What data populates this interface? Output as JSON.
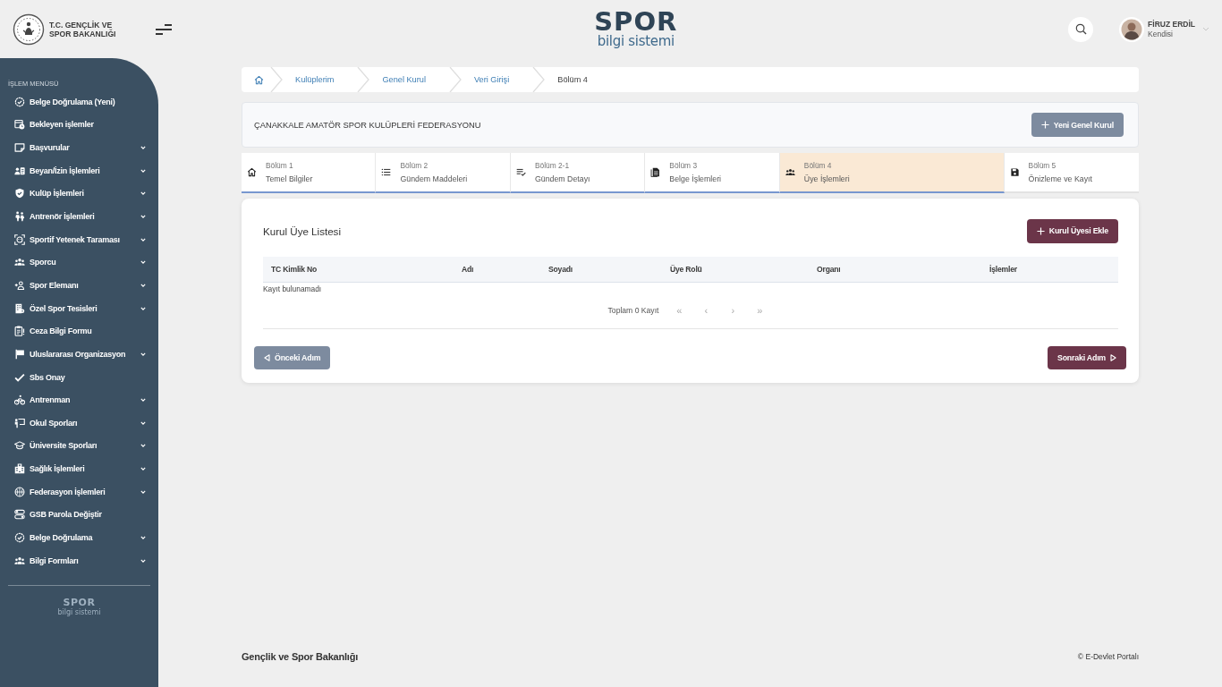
{
  "header": {
    "ministry_logo": {
      "lines": [
        "T.C. GENÇLİK VE",
        "SPOR BAKANLIĞI"
      ]
    },
    "app_logo": {
      "title": "SPOR",
      "subtitle": "bilgi sistemi"
    },
    "user": {
      "name": "FİRUZ ERDİL",
      "role": "Kendisi"
    }
  },
  "sidebar": {
    "heading": "İŞLEM MENÜSÜ",
    "items": [
      {
        "label": "Belge Doğrulama (Yeni)",
        "has_submenu": false
      },
      {
        "label": "Bekleyen işlemler",
        "has_submenu": false
      },
      {
        "label": "Başvurular",
        "has_submenu": true
      },
      {
        "label": "Beyan/İzin İşlemleri",
        "has_submenu": true
      },
      {
        "label": "Kulüp İşlemleri",
        "has_submenu": true
      },
      {
        "label": "Antrenör İşlemleri",
        "has_submenu": true
      },
      {
        "label": "Sportif Yetenek Taraması",
        "has_submenu": true
      },
      {
        "label": "Sporcu",
        "has_submenu": true
      },
      {
        "label": "Spor Elemanı",
        "has_submenu": true
      },
      {
        "label": "Özel Spor Tesisleri",
        "has_submenu": true
      },
      {
        "label": "Ceza Bilgi Formu",
        "has_submenu": false
      },
      {
        "label": "Uluslararası Organizasyon",
        "has_submenu": true
      },
      {
        "label": "Sbs Onay",
        "has_submenu": false
      },
      {
        "label": "Antrenman",
        "has_submenu": true
      },
      {
        "label": "Okul Sporları",
        "has_submenu": true
      },
      {
        "label": "Üniversite Sporları",
        "has_submenu": true
      },
      {
        "label": "Sağlık İşlemleri",
        "has_submenu": true
      },
      {
        "label": "Federasyon İşlemleri",
        "has_submenu": true
      },
      {
        "label": "GSB Parola Değiştir",
        "has_submenu": false
      },
      {
        "label": "Belge Doğrulama",
        "has_submenu": true
      },
      {
        "label": "Bilgi Formları",
        "has_submenu": true
      }
    ],
    "footer_logo": {
      "title": "SPOR",
      "subtitle": "bilgi sistemi"
    }
  },
  "breadcrumb": [
    {
      "label": "Kulüplerim",
      "current": false
    },
    {
      "label": "Genel Kurul",
      "current": false
    },
    {
      "label": "Veri Girişi",
      "current": false
    },
    {
      "label": "Bölüm 4",
      "current": true
    }
  ],
  "organization": {
    "name": "ÇANAKKALE AMATÖR SPOR KULÜPLERİ FEDERASYONU",
    "button": "Yeni Genel Kurul"
  },
  "steps": [
    {
      "step": "Bölüm 1",
      "title": "Temel Bilgiler",
      "selected": false,
      "reached": true
    },
    {
      "step": "Bölüm 2",
      "title": "Gündem Maddeleri",
      "selected": false,
      "reached": true
    },
    {
      "step": "Bölüm 2-1",
      "title": "Gündem Detayı",
      "selected": false,
      "reached": true
    },
    {
      "step": "Bölüm 3",
      "title": "Belge İşlemleri",
      "selected": false,
      "reached": true
    },
    {
      "step": "Bölüm 4",
      "title": "Üye İşlemleri",
      "selected": true,
      "reached": true
    },
    {
      "step": "Bölüm 5",
      "title": "Önizleme ve Kayıt",
      "selected": false,
      "reached": false
    }
  ],
  "members": {
    "title": "Kurul Üye Listesi",
    "add_button": "Kurul Üyesi Ekle",
    "table": {
      "columns": [
        "TC Kimlik No",
        "Adı",
        "Soyadı",
        "Üye Rolü",
        "Organı",
        "İşlemler"
      ],
      "empty_message": "Kayıt bulunamadı"
    },
    "pagination": {
      "summary": "Toplam 0 Kayıt",
      "buttons": [
        {
          "label": "«",
          "disabled": true
        },
        {
          "label": "‹",
          "disabled": true
        },
        {
          "label": "›",
          "disabled": true
        },
        {
          "label": "»",
          "disabled": true
        }
      ]
    },
    "previous_button": "Önceki Adım",
    "next_button": "Sonraki Adım"
  },
  "footer": {
    "left": "Gençlik ve Spor Bakanlığı",
    "right": "© E-Devlet Portalı"
  }
}
